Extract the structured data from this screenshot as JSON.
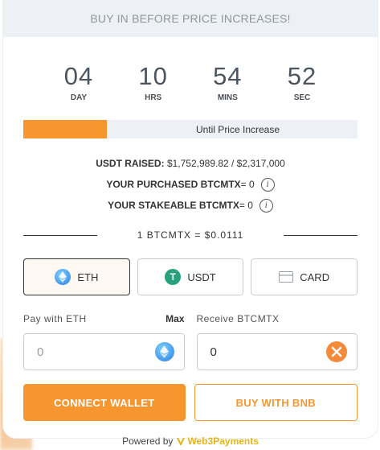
{
  "banner": {
    "text": "BUY IN BEFORE PRICE INCREASES!"
  },
  "countdown": [
    {
      "value": "04",
      "label": "DAY"
    },
    {
      "value": "10",
      "label": "HRS"
    },
    {
      "value": "54",
      "label": "MINS"
    },
    {
      "value": "52",
      "label": "SEC"
    }
  ],
  "progress": {
    "fraction": 0.25,
    "label": "Until Price Increase"
  },
  "stats": {
    "raised_label": "USDT RAISED:",
    "raised_value": "$1,752,989.82 / $2,317,000",
    "purchased_label": "YOUR PURCHASED BTCMTX",
    "purchased_value": "= 0",
    "stakeable_label": "YOUR STAKEABLE BTCMTX",
    "stakeable_value": "= 0"
  },
  "rate": {
    "text": "1 BTCMTX = $0.0111"
  },
  "payment_tabs": [
    {
      "label": "ETH",
      "icon": "eth-icon",
      "selected": true
    },
    {
      "label": "USDT",
      "icon": "usdt-icon",
      "selected": false
    },
    {
      "label": "CARD",
      "icon": "card-icon",
      "selected": false
    }
  ],
  "pay_field": {
    "label": "Pay with ETH",
    "max_label": "Max",
    "placeholder": "0",
    "icon": "eth-icon"
  },
  "receive_field": {
    "label": "Receive BTCMTX",
    "value": "0",
    "icon": "btcmtx-icon"
  },
  "buttons": {
    "connect": "CONNECT WALLET",
    "buy_bnb": "BUY WITH BNB"
  },
  "footer": {
    "powered_by": "Powered by",
    "brand": "Web3Payments"
  },
  "colors": {
    "accent": "#f7962f",
    "banner_bg": "#edf1f5",
    "brand_yellow": "#e6b517"
  }
}
